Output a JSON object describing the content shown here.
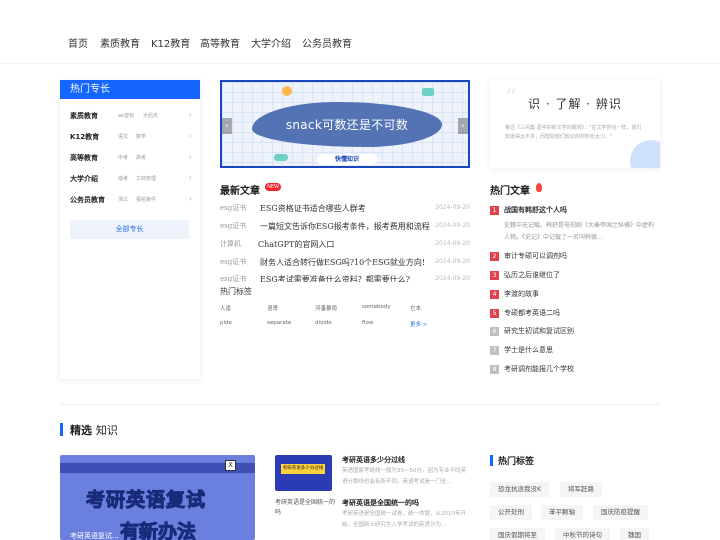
{
  "nav": [
    "首页",
    "素质教育",
    "K12教育",
    "高等教育",
    "大学介绍",
    "公务员教育"
  ],
  "left_panel": {
    "title": "热门专长",
    "rows": [
      {
        "title": "素质教育",
        "subs": [
          "ae音标",
          "大后天"
        ]
      },
      {
        "title": "K12教育",
        "subs": [
          "语文",
          "数学"
        ]
      },
      {
        "title": "高等教育",
        "subs": [
          "中考",
          "高考"
        ]
      },
      {
        "title": "大学介绍",
        "subs": [
          "成考",
          "工商管理"
        ]
      },
      {
        "title": "公务员教育",
        "subs": [
          "浙江",
          "报名条件"
        ]
      }
    ],
    "all_button": "全部专长"
  },
  "banner": {
    "text": "snack可数还是不可数",
    "sub": "快懂知识"
  },
  "quote": {
    "title": "识 · 了解 · 辨识",
    "text": "鲁迅《三闲集·葛亭的新文学的概观》：\"在文学界也一样，我们知道得太不多，而帮助我们知识的材料也太少。\""
  },
  "latest": {
    "title": "最新文章",
    "badge": "NEW",
    "items": [
      {
        "cat": "esg证书",
        "title": "ESG资格证书适合哪些人群考",
        "date": "2024-09-20"
      },
      {
        "cat": "esg证书",
        "title": "一篇短文告诉你ESG报考条件，报考费用和流程",
        "date": "2024-09-20"
      },
      {
        "cat": "计算机",
        "title": "ChatGPT的官网入口",
        "date": "2024-09-20"
      },
      {
        "cat": "esg证书",
        "title": "财务人适合转行做ESG吗?10个ESG就业方向!",
        "date": "2024-09-20"
      },
      {
        "cat": "esg证书",
        "title": "ESG考试需要准备什么资料？都需要什么?",
        "date": "2024-09-20"
      }
    ]
  },
  "hot_tags_small": {
    "title": "热门标签",
    "tags": [
      "人逢",
      "语贤",
      "河蚤暴雨",
      "somebody",
      "它本",
      "pide",
      "separate",
      "divide",
      "flow"
    ],
    "more": "更多 >"
  },
  "hot_articles": {
    "title": "热门文章",
    "desc": "史籍中无记载。韩舒是电视剧《大秦帝国之纵横》中虚构人物。《史记》中记载了一名叫韩德...",
    "items": [
      "战国有韩舒这个人吗",
      "审计专硕可以调剂吗",
      "弘历之后谁继位了",
      "李渡的故事",
      "专硕都考英语二吗",
      "研究生初试和复试区别",
      "学士是什么意思",
      "考研调剂能报几个学校"
    ]
  },
  "featured": {
    "title_bold": "精选",
    "title_rest": "知识"
  },
  "promo": {
    "text1": "考研英语复试",
    "text2": "有新办法",
    "caption": "考研英语复试..."
  },
  "thumb": {
    "text": "考研英语多少分过线",
    "alt": "考研英语是全国统一的吗"
  },
  "bottom_articles": [
    {
      "title": "考研英语多少分过线",
      "desc": "英语国家考研线一般为30—50分，因为专业不同英语分数线也会有所不同，英语考试是一门全..."
    },
    {
      "title": "考研英语是全国统一的吗",
      "desc": "考研英语是全国统一试卷，统一命题，从2010年开始，全国硕士研究生入学考试的英语分为..."
    }
  ],
  "bottom_tags": {
    "title": "热门标签",
    "tags": [
      "恐龙抗浪我没K",
      "将军赶路",
      "公开处刑",
      "苯平颗轴",
      "国庆防疫提醒",
      "国庆假期将至",
      "中秋节的诗句",
      "魏国"
    ]
  }
}
